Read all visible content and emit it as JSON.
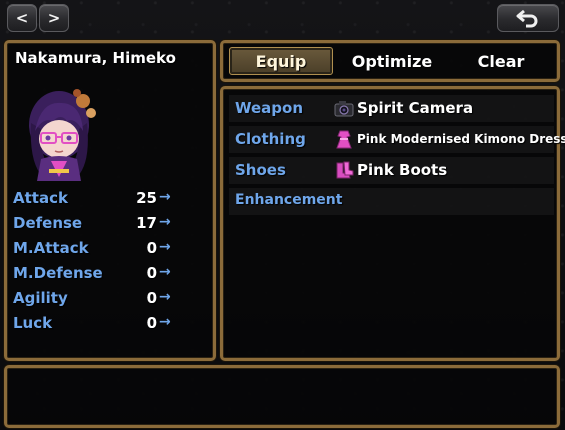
{
  "nav": {
    "prev_glyph": "<",
    "next_glyph": ">",
    "back_icon": "return-arrow-icon"
  },
  "actor": {
    "name": "Nakamura, Himeko",
    "portrait": "chibi-purple-hair-glasses"
  },
  "stats": [
    {
      "label": "Attack",
      "value": "25",
      "arrow": "→"
    },
    {
      "label": "Defense",
      "value": "17",
      "arrow": "→"
    },
    {
      "label": "M.Attack",
      "value": "0",
      "arrow": "→"
    },
    {
      "label": "M.Defense",
      "value": "0",
      "arrow": "→"
    },
    {
      "label": "Agility",
      "value": "0",
      "arrow": "→"
    },
    {
      "label": "Luck",
      "value": "0",
      "arrow": "→"
    }
  ],
  "commands": {
    "equip": "Equip",
    "optimize": "Optimize",
    "clear": "Clear",
    "selected": "Equip"
  },
  "slots": [
    {
      "label": "Weapon",
      "item": "Spirit Camera",
      "icon": "camera-icon"
    },
    {
      "label": "Clothing",
      "item": "Pink Modernised Kimono Dress",
      "icon": "dress-icon"
    },
    {
      "label": "Shoes",
      "item": "Pink Boots",
      "icon": "boots-icon"
    },
    {
      "label": "Enhancement",
      "item": "",
      "icon": ""
    }
  ],
  "colors": {
    "frame": "#8b6b3a",
    "label_blue": "#6fa6ea",
    "text": "#ffffff",
    "accent_pink": "#e24fc4"
  }
}
